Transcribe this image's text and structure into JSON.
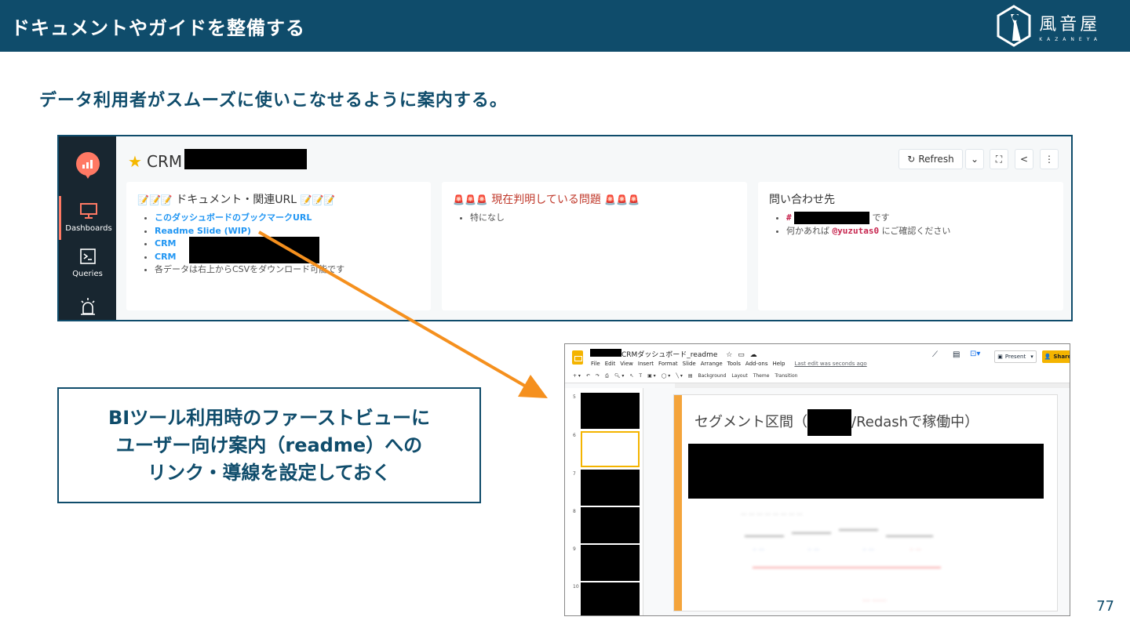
{
  "header": {
    "title": "ドキュメントやガイドを整備する"
  },
  "logo": {
    "name": "風音屋",
    "sub": "KAZANEYA"
  },
  "subtitle": "データ利用者がスムーズに使いこなせるように案内する。",
  "redash": {
    "sidebar": [
      {
        "label": "Dashboards",
        "icon": "monitor-icon"
      },
      {
        "label": "Queries",
        "icon": "terminal-icon"
      },
      {
        "label": "",
        "icon": "alert-icon"
      }
    ],
    "dashboard_title": "CRM",
    "buttons": {
      "refresh": "Refresh"
    },
    "panels": [
      {
        "heading": "ドキュメント・関連URL",
        "items": [
          {
            "text": "このダッシュボードのブックマークURL",
            "link": true
          },
          {
            "text": "Readme Slide (WIP)",
            "link": true
          },
          {
            "text": "CRM",
            "link": true
          },
          {
            "text": "CRM",
            "link": true
          },
          {
            "text": "各データは右上からCSVをダウンロード可能です",
            "link": false
          }
        ]
      },
      {
        "heading": "現在判明している問題",
        "items": [
          {
            "text": "特になし",
            "link": false
          }
        ]
      },
      {
        "heading": "問い合わせ先",
        "items": [
          {
            "prefix": "#",
            "suffix": "です"
          },
          {
            "prefix": "何かあれば",
            "mention": "@yuzutas0",
            "suffix": "にご確認ください"
          }
        ]
      }
    ]
  },
  "callout": {
    "lines": [
      "BIツール利用時のファーストビューに",
      "ユーザー向け案内（readme）への",
      "リンク・導線を設定しておく"
    ]
  },
  "slides": {
    "doc_title": "CRMダッシュボード_readme",
    "menu": [
      "File",
      "Edit",
      "View",
      "Insert",
      "Format",
      "Slide",
      "Arrange",
      "Tools",
      "Add-ons",
      "Help"
    ],
    "last_edit": "Last edit was seconds ago",
    "toolbar": [
      "Background",
      "Layout",
      "Theme",
      "Transition"
    ],
    "present": "Present",
    "share": "Share",
    "thumb_numbers": [
      "5",
      "6",
      "7",
      "8",
      "9",
      "10"
    ],
    "slide_title_prefix": "セグメント区間（",
    "slide_title_suffix": "/Redashで稼働中）"
  },
  "page_number": "77",
  "colors": {
    "brand": "#0f4c6b",
    "arrow": "#f5901e",
    "slides_accent": "#f4b400"
  }
}
